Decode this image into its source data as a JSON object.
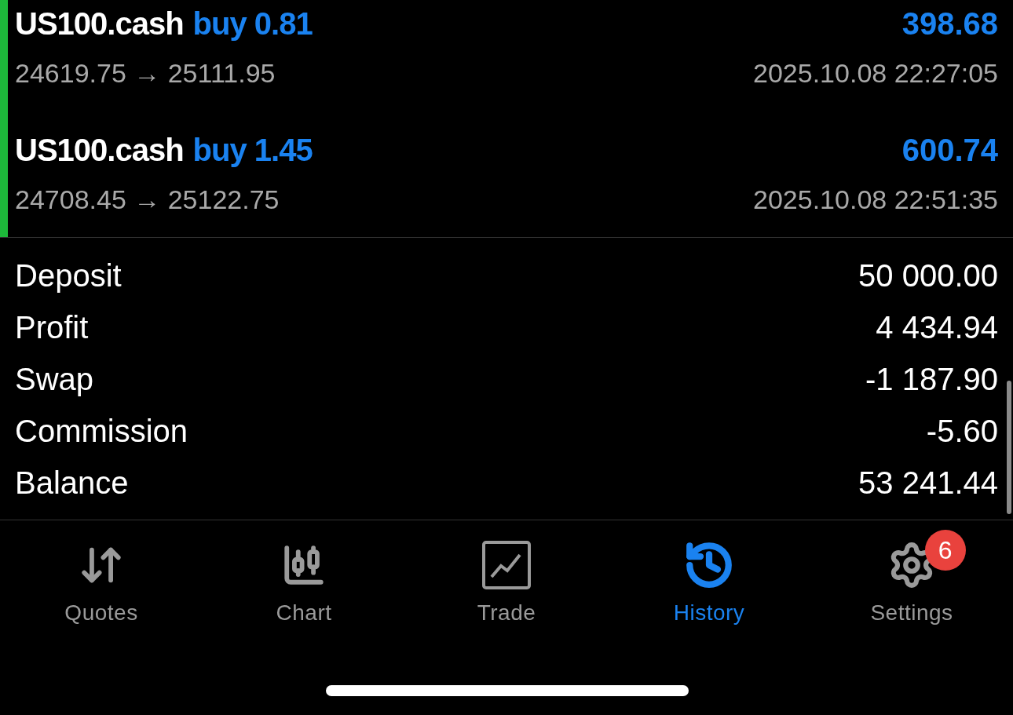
{
  "deals": [
    {
      "symbol": "US100.cash",
      "type": "buy",
      "volume": "0.81",
      "prices": "24619.75 → 25111.95",
      "time": "2025.10.08 22:27:05",
      "profit": "398.68"
    },
    {
      "symbol": "US100.cash",
      "type": "buy",
      "volume": "1.45",
      "prices": "24708.45 → 25122.75",
      "time": "2025.10.08 22:51:35",
      "profit": "600.74"
    }
  ],
  "summary": [
    {
      "label": "Deposit",
      "value": "50 000.00"
    },
    {
      "label": "Profit",
      "value": "4 434.94"
    },
    {
      "label": "Swap",
      "value": "-1 187.90"
    },
    {
      "label": "Commission",
      "value": "-5.60"
    },
    {
      "label": "Balance",
      "value": "53 241.44"
    }
  ],
  "tabs": [
    {
      "kind": "quotes",
      "label": "Quotes",
      "selected": false
    },
    {
      "kind": "chart",
      "label": "Chart",
      "selected": false
    },
    {
      "kind": "trade",
      "label": "Trade",
      "selected": false
    },
    {
      "kind": "history",
      "label": "History",
      "selected": true
    },
    {
      "kind": "settings",
      "label": "Settings",
      "selected": false,
      "badge": "6"
    }
  ]
}
